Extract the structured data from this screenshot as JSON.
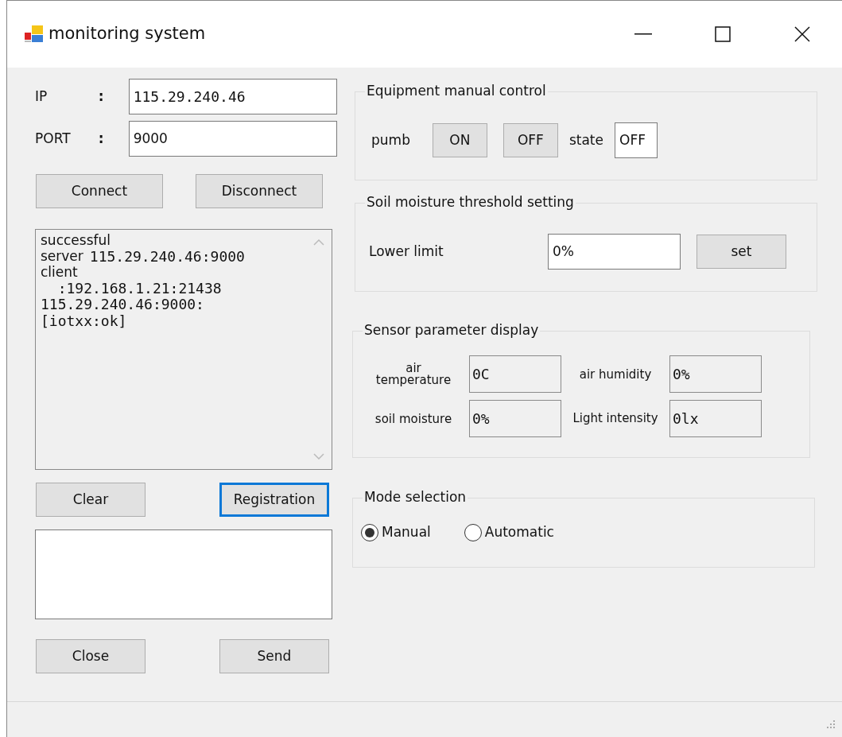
{
  "window": {
    "title": "monitoring system"
  },
  "connection": {
    "fields": [
      {
        "label": "IP",
        "value": "115.29.240.46",
        "mono": true
      },
      {
        "label": "PORT",
        "value": "9000",
        "mono": false
      }
    ],
    "separator": ":"
  },
  "connection_buttons": [
    {
      "label": "Connect",
      "focused": false
    },
    {
      "label": "Disconnect",
      "focused": false
    }
  ],
  "log": {
    "lines": [
      {
        "text": "successful",
        "mono": false
      },
      {
        "text": "server",
        "mono": false,
        "suffix": "115.29.240.46:9000"
      },
      {
        "text": "client",
        "mono": false
      },
      {
        "text": "  :192.168.1.21:21438",
        "mono": true
      },
      {
        "text": "115.29.240.46:9000:",
        "mono": true
      },
      {
        "text": "[iotxx:ok]",
        "mono": true
      }
    ]
  },
  "log_buttons": [
    {
      "label": "Clear",
      "focused": false
    },
    {
      "label": "Registration",
      "focused": true
    }
  ],
  "send_buttons": [
    {
      "label": "Close",
      "focused": false
    },
    {
      "label": "Send",
      "focused": false
    }
  ],
  "equipment": {
    "title": "Equipment manual control",
    "device": "pumb",
    "buttons": [
      {
        "label": "ON"
      },
      {
        "label": "OFF"
      }
    ],
    "state_label": "state",
    "state": "OFF"
  },
  "threshold": {
    "title": "Soil moisture threshold setting",
    "label": "Lower limit",
    "value": "0%",
    "button": "set"
  },
  "sensors": {
    "title": "Sensor parameter display",
    "items": [
      {
        "label": "air temperature",
        "value": "0C"
      },
      {
        "label": "air humidity",
        "value": "0%"
      },
      {
        "label": "soil moisture",
        "value": "0%"
      },
      {
        "label": "Light intensity",
        "value": "0lx"
      }
    ]
  },
  "mode": {
    "title": "Mode selection",
    "options": [
      {
        "label": "Manual",
        "selected": true
      },
      {
        "label": "Automatic",
        "selected": false
      }
    ]
  }
}
